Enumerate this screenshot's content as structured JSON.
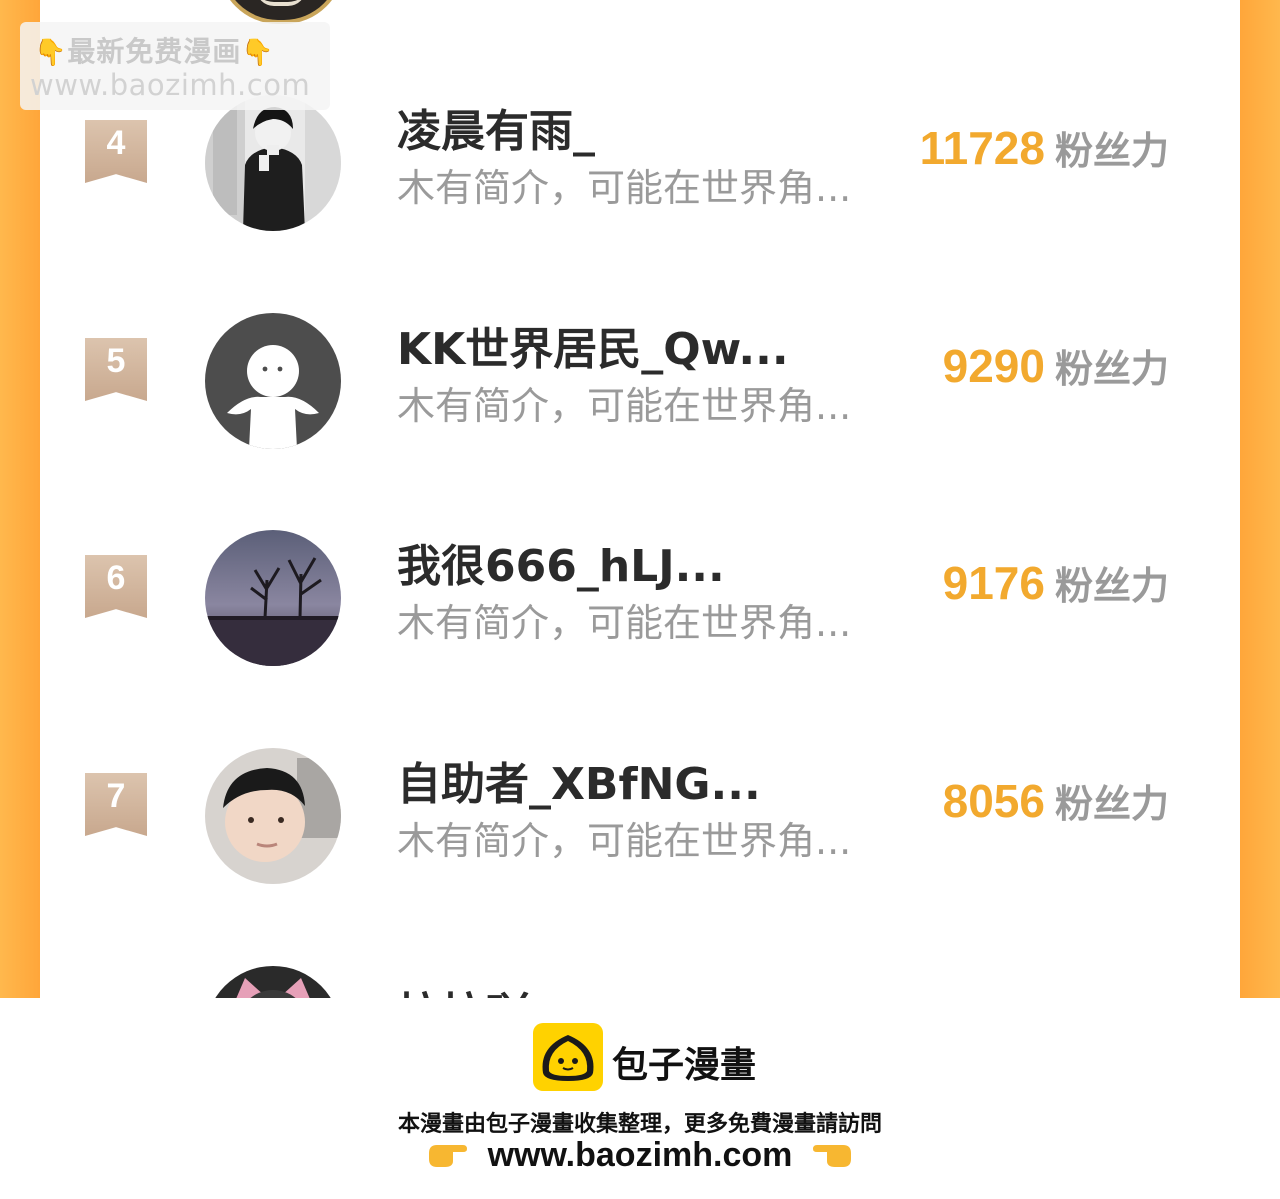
{
  "watermark": {
    "line1": "最新免费漫画",
    "line2": "www.baozimh.com"
  },
  "rows": [
    {
      "rank": "4",
      "name": "凌晨有雨_",
      "desc": "木有简介，可能在世界角...",
      "score": "11728",
      "unit": "粉丝力"
    },
    {
      "rank": "5",
      "name": "KK世界居民_Qw...",
      "desc": "木有简介，可能在世界角...",
      "score": "9290",
      "unit": "粉丝力"
    },
    {
      "rank": "6",
      "name": "我很666_hLJ...",
      "desc": "木有简介，可能在世界角...",
      "score": "9176",
      "unit": "粉丝力"
    },
    {
      "rank": "7",
      "name": "自助者_XBfNG...",
      "desc": "木有简介，可能在世界角...",
      "score": "8056",
      "unit": "粉丝力"
    },
    {
      "name": "拉拉吖"
    }
  ],
  "footer": {
    "brand": "包子漫畫",
    "note": "本漫畫由包子漫畫收集整理，更多免費漫畫請訪問",
    "url": "www.baozimh.com"
  },
  "colors": {
    "accent_orange": "#ffa63a",
    "score": "#f2a92e",
    "rank_badge": "#c8a88e",
    "logo_yellow": "#ffd200"
  }
}
